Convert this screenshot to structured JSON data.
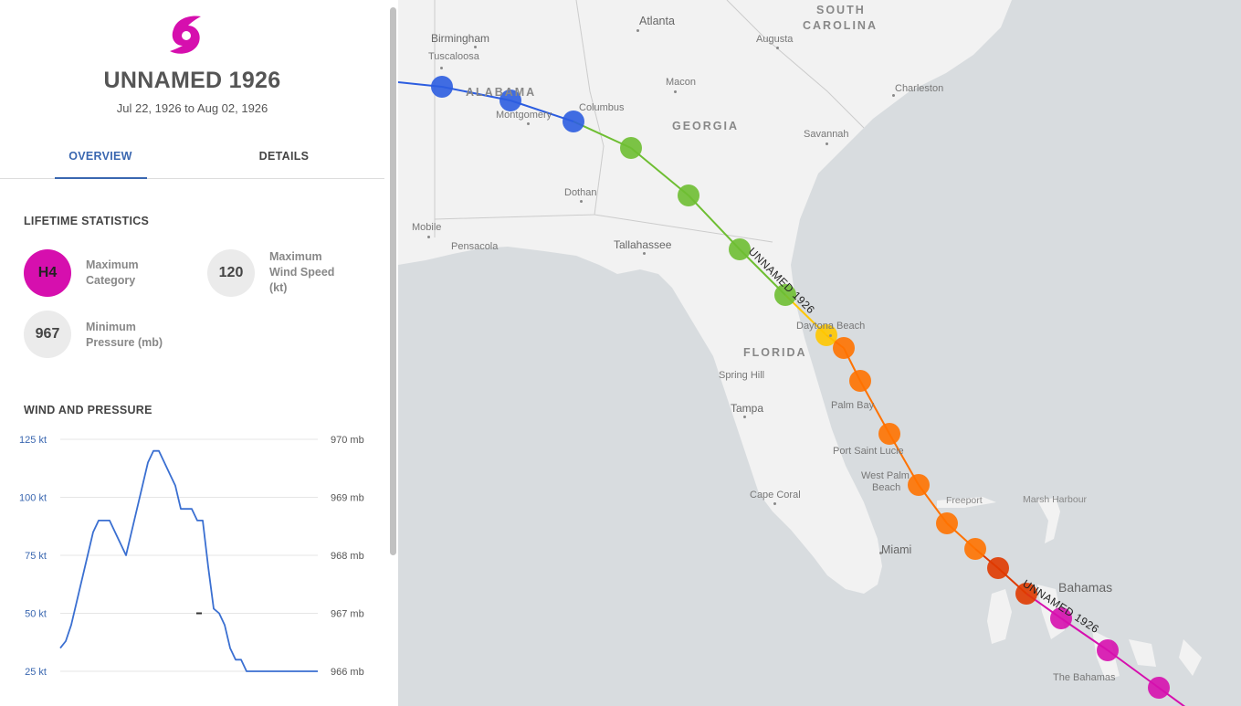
{
  "storm": {
    "name": "UNNAMED 1926",
    "dates": "Jul 22, 1926 to Aug 02, 1926",
    "icon": "hurricane-icon",
    "icon_color": "#d60fae"
  },
  "tabs": [
    {
      "label": "OVERVIEW",
      "active": true
    },
    {
      "label": "DETAILS",
      "active": false
    }
  ],
  "lifetime": {
    "title": "LIFETIME STATISTICS",
    "max_category": {
      "value": "H4",
      "label_line1": "Maximum",
      "label_line2": "Category",
      "color": "#d60fae"
    },
    "max_wind": {
      "value": "120",
      "label_line1": "Maximum",
      "label_line2": "Wind Speed",
      "label_line3": "(kt)"
    },
    "min_pressure": {
      "value": "967",
      "label_line1": "Minimum",
      "label_line2": "Pressure (mb)"
    }
  },
  "wind_pressure": {
    "title": "WIND AND PRESSURE"
  },
  "chart_data": {
    "type": "line",
    "left_axis_ticks": [
      "125 kt",
      "100 kt",
      "75 kt",
      "50 kt",
      "25 kt"
    ],
    "right_axis_ticks": [
      "970 mb",
      "969 mb",
      "968 mb",
      "967 mb",
      "966 mb"
    ],
    "ylim": [
      25,
      125
    ],
    "y2lim": [
      966,
      970
    ],
    "series": [
      {
        "color": "#3a6fd1",
        "values": [
          35,
          38,
          45,
          55,
          65,
          75,
          85,
          90,
          90,
          90,
          85,
          80,
          75,
          85,
          95,
          105,
          115,
          120,
          120,
          115,
          110,
          105,
          95,
          95,
          95,
          90,
          90,
          70,
          52,
          50,
          45,
          35,
          30,
          30,
          25,
          25,
          25,
          25,
          25,
          25,
          25,
          25,
          25,
          25,
          25,
          25,
          25,
          25
        ]
      },
      {
        "color": "#333333",
        "values": [
          967
        ]
      }
    ]
  },
  "map": {
    "track_label": "UNNAMED 1926",
    "colors": {
      "td": "#2c5de0",
      "ts": "#6ebe32",
      "h1": "#ffc600",
      "h2": "#ff7200",
      "h3": "#e03a00",
      "h4": "#d60fae"
    },
    "labels": {
      "atlanta": "Atlanta",
      "south": "SOUTH",
      "carolina": "CAROLINA",
      "birmingham": "Birmingham",
      "augusta": "Augusta",
      "tuscaloosa": "Tuscaloosa",
      "alabama": "ALABAMA",
      "macon": "Macon",
      "charleston": "Charleston",
      "columbus": "Columbus",
      "montgomery": "Montgomery",
      "georgia": "GEORGIA",
      "savannah": "Savannah",
      "dothan": "Dothan",
      "mobile": "Mobile",
      "tallahassee": "Tallahassee",
      "pensacola": "Pensacola",
      "daytona": "Daytona Beach",
      "florida": "FLORIDA",
      "spring_hill": "Spring Hill",
      "tampa": "Tampa",
      "palm_bay": "Palm Bay",
      "port_saint_lucie": "Port Saint Lucie",
      "west_palm_1": "West Palm",
      "west_palm_2": "Beach",
      "cape_coral": "Cape Coral",
      "freeport": "Freeport",
      "marsh_harbour": "Marsh Harbour",
      "miami": "Miami",
      "bahamas": "Bahamas",
      "the_bahamas": "The Bahamas"
    }
  }
}
